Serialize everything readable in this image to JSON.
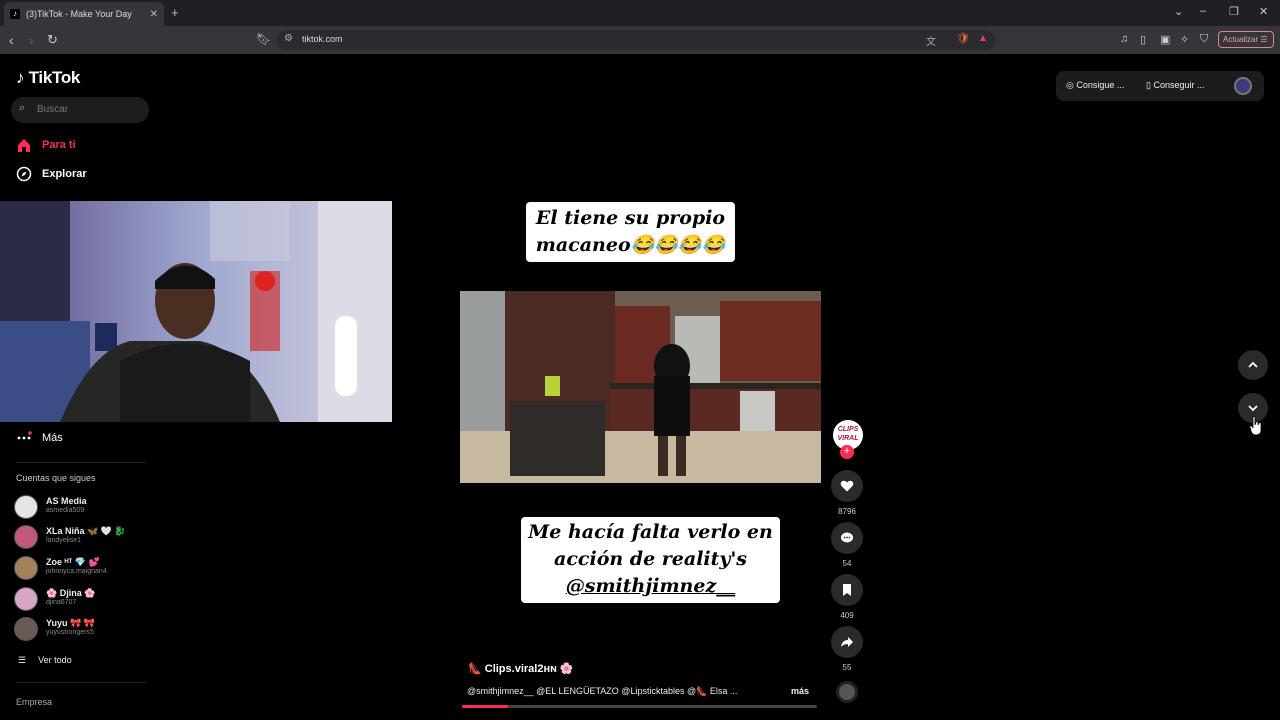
{
  "browser": {
    "tab_title": "(3)TikTok - Make Your Day",
    "url": "tiktok.com",
    "update_button": "Actualizar"
  },
  "sidebar": {
    "logo": "TikTok",
    "search_placeholder": "Buscar",
    "nav": [
      {
        "label": "Para ti",
        "icon": "home-icon",
        "active": true
      },
      {
        "label": "Explorar",
        "icon": "compass-icon",
        "active": false
      },
      {
        "label": "Más",
        "icon": "more-dots-icon",
        "active": false
      }
    ],
    "following_title": "Cuentas que sigues",
    "following": [
      {
        "name": "AS Media",
        "user": "asmedia509"
      },
      {
        "name": "XLa Niña 🦋 🤍 🐉",
        "user": "landyelise1"
      },
      {
        "name": "Zoe ᴴᵀ 💎 💕",
        "user": "johnnyca.maignan4"
      },
      {
        "name": "🌸 Djina 🌸",
        "user": "djina6707"
      },
      {
        "name": "Yuyu 🎀 🎀",
        "user": "yuyustrongers5"
      }
    ],
    "see_all": "Ver todo",
    "footer_section": "Empresa"
  },
  "topbar": {
    "get_coins": "Consigue ...",
    "get_app": "Conseguir ..."
  },
  "video": {
    "caption_top": [
      "El tiene su propio",
      "macaneo😂😂😂😂"
    ],
    "caption_bottom": [
      "Me hacía falta verlo en",
      "acción de reality's",
      "@smithjimnez__"
    ],
    "author": "👠 Clips.viral2ʜɴ 🌸",
    "description": "@smithjimnez__ @EL LENGÜETAZO @Lipsticktables @👠 Elsa ...",
    "more": "más",
    "avatar_label": "CLIPS VIRAL",
    "likes": "8796",
    "comments": "54",
    "saves": "409",
    "shares": "55",
    "progress": 0.13
  },
  "colors": {
    "accent": "#fe2c55",
    "bg": "#000000"
  }
}
